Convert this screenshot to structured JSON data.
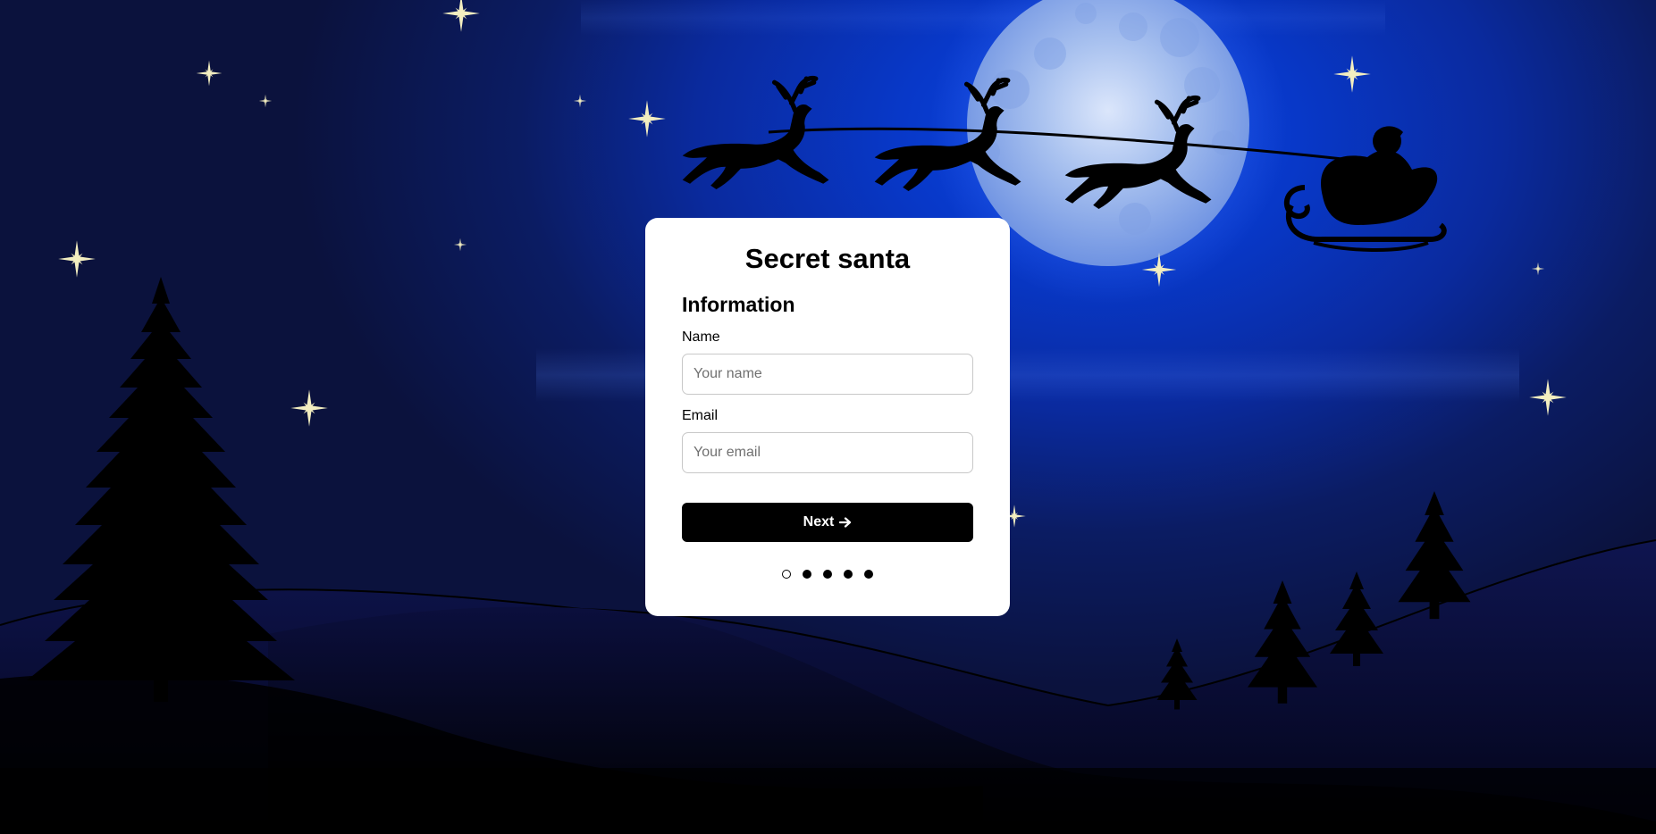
{
  "app": {
    "title": "Secret santa"
  },
  "form": {
    "section_title": "Information",
    "name_label": "Name",
    "name_placeholder": "Your name",
    "name_value": "",
    "email_label": "Email",
    "email_placeholder": "Your email",
    "email_value": "",
    "next_label": "Next",
    "next_icon": "arrow-right-icon"
  },
  "stepper": {
    "total_steps": 5,
    "current_step": 1
  },
  "colors": {
    "sky_top": "#0b123d",
    "sky_glow": "#0b47e6",
    "moon": "#9fb8ec",
    "silhouette": "#000000",
    "star": "#f3eec0",
    "card": "#ffffff",
    "button": "#000000"
  },
  "scene": {
    "background_elements": [
      "night-sky",
      "moon",
      "stars",
      "santa-sleigh-with-reindeer",
      "pine-trees",
      "snowy-hills"
    ]
  }
}
